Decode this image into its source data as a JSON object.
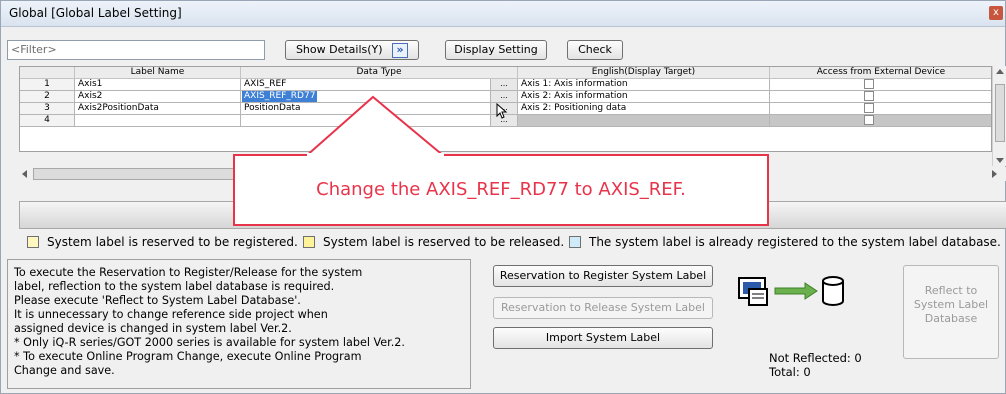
{
  "window": {
    "title": "Global [Global Label Setting]",
    "close_glyph": "x"
  },
  "toolbar": {
    "filter_placeholder": "<Filter>",
    "show_details_label": "Show Details(Y)",
    "show_details_icon": "»",
    "display_setting_label": "Display Setting",
    "check_label": "Check"
  },
  "table": {
    "headers": {
      "label_name": "Label Name",
      "data_type": "Data Type",
      "english": "English(Display Target)",
      "access": "Access from External Device"
    },
    "rows": [
      {
        "num": "1",
        "label": "Axis1",
        "type": "AXIS_REF",
        "english": "Axis 1: Axis information"
      },
      {
        "num": "2",
        "label": "Axis2",
        "type": "AXIS_REF_RD77",
        "english": "Axis 2: Axis information"
      },
      {
        "num": "3",
        "label": "Axis2PositionData",
        "type": "PositionData",
        "english": "Axis 2: Positioning data"
      },
      {
        "num": "4",
        "label": "",
        "type": "",
        "english": ""
      }
    ],
    "ellipsis": "..."
  },
  "legend": {
    "reserved_register": "System label is reserved to be registered.",
    "reserved_release": "System label is reserved to be released.",
    "already_registered": "The system label is already registered to the system label database.",
    "colors": {
      "register": "#fff7c0",
      "release": "#fff39a",
      "registered": "#cfeaf8"
    }
  },
  "info_text": [
    "To execute the Reservation to Register/Release for the system",
    "label, reflection to the system label database is required.",
    "Please execute 'Reflect to System Label Database'.",
    "It is unnecessary to change reference side project when",
    "assigned device is changed in system label Ver.2.",
    "* Only iQ-R series/GOT 2000 series is available for system label Ver.2.",
    "* To execute Online Program Change, execute Online Program",
    "Change and save."
  ],
  "actions": {
    "reserve_register": "Reservation to Register System Label",
    "reserve_release": "Reservation to Release System Label",
    "import": "Import System Label",
    "reflect_line1": "Reflect to",
    "reflect_line2": "System Label",
    "reflect_line3": "Database"
  },
  "status": {
    "not_reflected": "Not Reflected: 0",
    "total": "Total: 0"
  },
  "callout": {
    "text": "Change the AXIS_REF_RD77 to AXIS_REF."
  },
  "colors": {
    "selection": "#3e80d6",
    "callout_red": "#e8344b",
    "arrow_green": "#6ab04c"
  }
}
